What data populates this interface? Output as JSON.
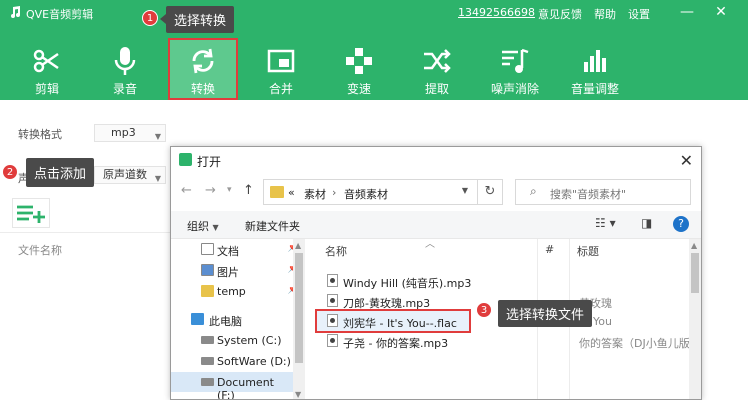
{
  "app": {
    "title": "QVE音频剪辑",
    "phone": "13492566698",
    "menu": [
      "意见反馈",
      "帮助",
      "设置"
    ]
  },
  "toolbar": [
    {
      "label": "剪辑",
      "icon": "scissors-icon"
    },
    {
      "label": "录音",
      "icon": "microphone-icon"
    },
    {
      "label": "转换",
      "icon": "convert-icon",
      "active": true
    },
    {
      "label": "合并",
      "icon": "merge-icon"
    },
    {
      "label": "变速",
      "icon": "speed-icon"
    },
    {
      "label": "提取",
      "icon": "extract-icon"
    },
    {
      "label": "噪声消除",
      "icon": "noise-icon"
    },
    {
      "label": "音量调整",
      "icon": "volume-icon"
    }
  ],
  "steps": {
    "s1": {
      "num": "1",
      "text": "选择转换"
    },
    "s2": {
      "num": "2",
      "text": "点击添加"
    },
    "s3": {
      "num": "3",
      "text": "选择转换文件"
    }
  },
  "settings": {
    "format_label": "转换格式",
    "format_value": "mp3",
    "channel_label": "声",
    "channel_value": "原声道数",
    "file_col": "文件名称"
  },
  "dialog": {
    "title": "打开",
    "breadcrumb": [
      "«",
      "素材",
      "音频素材"
    ],
    "search_placeholder": "搜索\"音频素材\"",
    "organize": "组织",
    "new_folder": "新建文件夹",
    "nav_items": [
      {
        "label": "文档",
        "icon": "document-icon",
        "pinned": true
      },
      {
        "label": "图片",
        "icon": "picture-icon",
        "pinned": true
      },
      {
        "label": "temp",
        "icon": "folder-icon",
        "pinned": true
      },
      {
        "label": "此电脑",
        "icon": "computer-icon",
        "pinned": false
      },
      {
        "label": "System (C:)",
        "icon": "drive-icon",
        "pinned": false
      },
      {
        "label": "SoftWare (D:)",
        "icon": "drive-icon",
        "pinned": false
      },
      {
        "label": "Document (F:)",
        "icon": "drive-icon",
        "pinned": false
      }
    ],
    "columns": {
      "name": "名称",
      "num": "#",
      "title": "标题"
    },
    "files": [
      {
        "name": "Windy Hill (纯音乐).mp3",
        "title": ""
      },
      {
        "name": "刀郎-黄玫瑰.mp3",
        "title": "黄玫瑰"
      },
      {
        "name": "刘宪华 - It's You--.flac",
        "title": "You"
      },
      {
        "name": "子尧 - 你的答案.mp3",
        "title": "你的答案（DJ小鱼儿版）"
      }
    ]
  },
  "colors": {
    "brand": "#2db36b",
    "accent": "#e03c3c"
  }
}
